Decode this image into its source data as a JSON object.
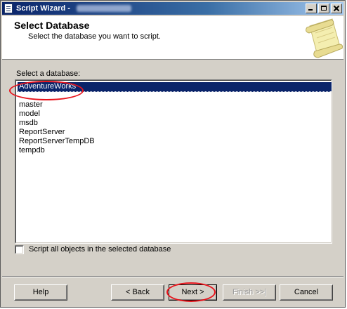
{
  "window": {
    "title": "Script Wizard - "
  },
  "header": {
    "title": "Select Database",
    "subtitle": "Select the database you want to script."
  },
  "database_list": {
    "label": "Select a database:",
    "selected": "AdventureWorks",
    "items": [
      "master",
      "model",
      "msdb",
      "ReportServer",
      "ReportServerTempDB",
      "tempdb"
    ]
  },
  "options": {
    "script_all_label": "Script all objects in the selected database",
    "script_all_checked": false
  },
  "buttons": {
    "help": "Help",
    "back": "< Back",
    "next": "Next >",
    "finish": "Finish >>|",
    "cancel": "Cancel"
  },
  "colors": {
    "selection": "#0a246a",
    "annotation": "#e8141c",
    "titlebar_start": "#0a246a",
    "titlebar_end": "#a6caf0"
  }
}
